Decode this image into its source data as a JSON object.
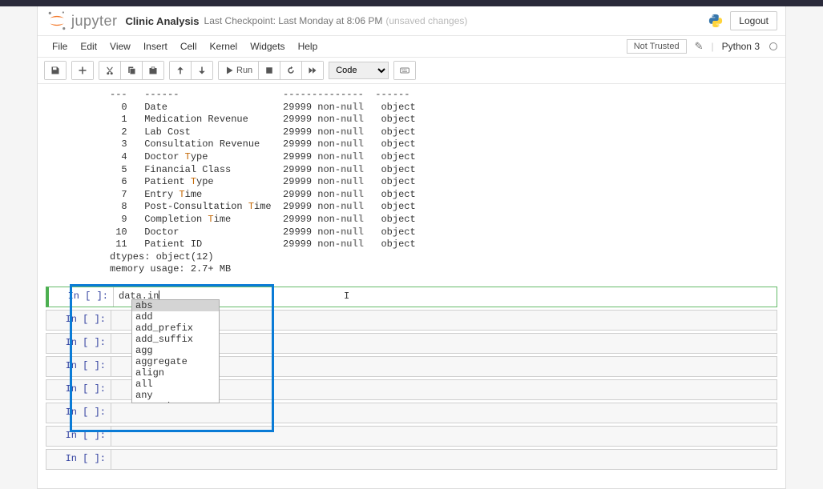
{
  "header": {
    "title": "Clinic Analysis",
    "checkpoint": "Last Checkpoint: Last Monday at 8:06 PM",
    "unsaved": "(unsaved changes)",
    "logout": "Logout",
    "logo_text": "jupyter"
  },
  "menubar": {
    "items": [
      "File",
      "Edit",
      "View",
      "Insert",
      "Cell",
      "Kernel",
      "Widgets",
      "Help"
    ],
    "not_trusted": "Not Trusted",
    "kernel": "Python 3"
  },
  "toolbar": {
    "run_label": "Run",
    "cell_type": "Code"
  },
  "output": {
    "header": "---   ------                  --------------  ------",
    "rows": [
      {
        "idx": "0",
        "col": "Date",
        "count": "29999 non-null",
        "dtype": "object"
      },
      {
        "idx": "1",
        "col": "Medication Revenue",
        "count": "29999 non-null",
        "dtype": "object"
      },
      {
        "idx": "2",
        "col": "Lab Cost",
        "count": "29999 non-null",
        "dtype": "object"
      },
      {
        "idx": "3",
        "col": "Consultation Revenue",
        "count": "29999 non-null",
        "dtype": "object"
      },
      {
        "idx": "4",
        "col": "Doctor Type",
        "count": "29999 non-null",
        "dtype": "object"
      },
      {
        "idx": "5",
        "col": "Financial Class",
        "count": "29999 non-null",
        "dtype": "object"
      },
      {
        "idx": "6",
        "col": "Patient Type",
        "count": "29999 non-null",
        "dtype": "object"
      },
      {
        "idx": "7",
        "col": "Entry Time",
        "count": "29999 non-null",
        "dtype": "object"
      },
      {
        "idx": "8",
        "col": "Post-Consultation Time",
        "count": "29999 non-null",
        "dtype": "object"
      },
      {
        "idx": "9",
        "col": "Completion Time",
        "count": "29999 non-null",
        "dtype": "object"
      },
      {
        "idx": "10",
        "col": "Doctor",
        "count": "29999 non-null",
        "dtype": "object"
      },
      {
        "idx": "11",
        "col": "Patient ID",
        "count": "29999 non-null",
        "dtype": "object"
      }
    ],
    "dtypes": "dtypes: object(12)",
    "memory": "memory usage: 2.7+ MB"
  },
  "active_cell": {
    "prompt": "In [ ]:",
    "code": "data.in"
  },
  "autocomplete": {
    "items": [
      "abs",
      "add",
      "add_prefix",
      "add_suffix",
      "agg",
      "aggregate",
      "align",
      "all",
      "any",
      "append"
    ],
    "selected": 0
  },
  "empty_cells": [
    {
      "prompt": "In [ ]:"
    },
    {
      "prompt": "In [ ]:"
    },
    {
      "prompt": "In [ ]:"
    },
    {
      "prompt": "In [ ]:"
    },
    {
      "prompt": "In [ ]:"
    },
    {
      "prompt": "In [ ]:"
    },
    {
      "prompt": "In [ ]:"
    }
  ]
}
